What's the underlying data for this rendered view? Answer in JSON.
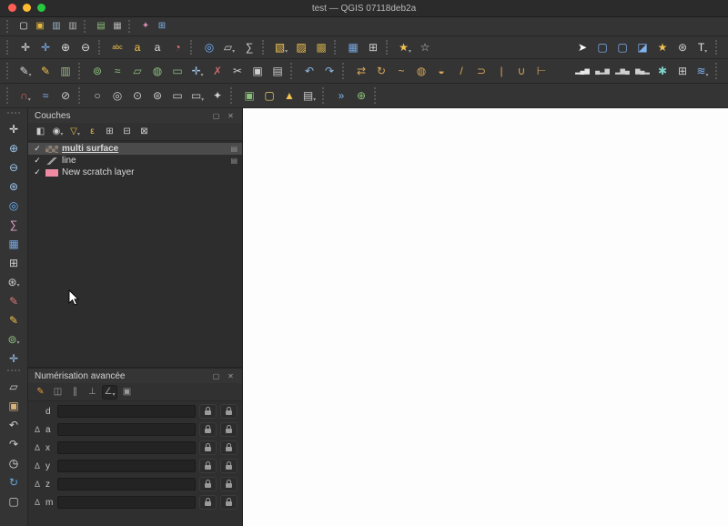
{
  "window": {
    "title": "test — QGIS 07118deb2a"
  },
  "traffic_lights": {
    "close": "#ff5f57",
    "minimize": "#febc2e",
    "zoom": "#28c840"
  },
  "toolbars": {
    "row1": [
      {
        "sep": true
      },
      {
        "n": "new-project",
        "g": "▢",
        "c": "#e8e8e8"
      },
      {
        "n": "open-project",
        "g": "▣",
        "c": "#e3b93d"
      },
      {
        "n": "save-project",
        "g": "▥",
        "c": "#9fb6c9"
      },
      {
        "n": "save-project-as",
        "g": "▥",
        "c": "#b5b5b5"
      },
      {
        "sep": true
      },
      {
        "n": "new-print-layout",
        "g": "▤",
        "c": "#8cc07a"
      },
      {
        "n": "layout-manager",
        "g": "▦",
        "c": "#b5b5b5"
      },
      {
        "sep": true
      },
      {
        "n": "style-manager",
        "g": "✦",
        "c": "#d98cb3"
      },
      {
        "n": "data-source-manager",
        "g": "⊞",
        "c": "#7fb3f0"
      }
    ],
    "row2": [
      {
        "sep": true
      },
      {
        "n": "pan-map",
        "g": "✛",
        "c": "#e0e0e0"
      },
      {
        "n": "pan-to-selection",
        "g": "✛",
        "c": "#7fb3f0"
      },
      {
        "n": "zoom-in",
        "g": "⊕",
        "c": "#dcdcdc"
      },
      {
        "n": "zoom-out",
        "g": "⊖",
        "c": "#dcdcdc"
      },
      {
        "sep": true
      },
      {
        "n": "layer-labeling",
        "g": "abc",
        "c": "#f2c14e",
        "fs": 7
      },
      {
        "n": "label-pin",
        "g": "a",
        "c": "#f2c14e"
      },
      {
        "n": "move-label",
        "g": "a",
        "c": "#dcdcdc"
      },
      {
        "n": "diagram-options",
        "g": "◔",
        "c": "#e07b7b"
      },
      {
        "sep": true
      },
      {
        "n": "identify-features",
        "g": "◎",
        "c": "#6fb3ff"
      },
      {
        "n": "measure-line",
        "g": "▱",
        "c": "#cfcfcf",
        "dd": true
      },
      {
        "n": "statistical-summary",
        "g": "∑",
        "c": "#cfcfcf"
      },
      {
        "sep": true
      },
      {
        "n": "select-by-rectangle",
        "g": "▧",
        "c": "#f2c14e",
        "dd": true
      },
      {
        "n": "select-by-value",
        "g": "▨",
        "c": "#f2c14e"
      },
      {
        "n": "deselect-all",
        "g": "▩",
        "c": "#bfa14a"
      },
      {
        "sep": true
      },
      {
        "n": "open-attribute-table",
        "g": "▦",
        "c": "#79a8e0"
      },
      {
        "n": "field-calculator",
        "g": "⊞",
        "c": "#cfcfcf"
      },
      {
        "sep": true
      },
      {
        "n": "new-bookmark",
        "g": "★",
        "c": "#f2c14e",
        "dd": true
      },
      {
        "n": "show-bookmarks",
        "g": "☆",
        "c": "#cfcfcf"
      },
      {
        "sp": true
      },
      {
        "n": "select-tool",
        "g": "➤",
        "c": "#ffffff"
      },
      {
        "n": "select-features-by-area",
        "g": "▢",
        "c": "#7fb3f0"
      },
      {
        "n": "select-by-freehand",
        "g": "▢",
        "c": "#7fb3f0"
      },
      {
        "n": "invert-selection",
        "g": "◪",
        "c": "#7fb3f0"
      },
      {
        "n": "favorites",
        "g": "★",
        "c": "#f2c14e"
      },
      {
        "n": "processing-toolbox",
        "g": "⊛",
        "c": "#cfcfcf"
      },
      {
        "n": "text-annotation",
        "g": "T",
        "c": "#e8e8e8",
        "dd": true
      },
      {
        "sep": true
      }
    ],
    "row3": [
      {
        "sep": true
      },
      {
        "n": "current-edits",
        "g": "✎",
        "c": "#dcdcdc",
        "dd": true
      },
      {
        "n": "toggle-editing",
        "g": "✎",
        "c": "#f2c14e"
      },
      {
        "n": "save-layer-edits",
        "g": "▥",
        "c": "#9fb98a"
      },
      {
        "sep": true
      },
      {
        "n": "add-point-feature",
        "g": "⊚",
        "c": "#8cc07a"
      },
      {
        "n": "add-line-feature",
        "g": "≈",
        "c": "#8cc07a"
      },
      {
        "n": "add-polygon-feature",
        "g": "▱",
        "c": "#8cc07a"
      },
      {
        "n": "add-circle-feature",
        "g": "◍",
        "c": "#8cc07a"
      },
      {
        "n": "add-rectangle-feature",
        "g": "▭",
        "c": "#8cc07a"
      },
      {
        "n": "vertex-tool",
        "g": "✛",
        "c": "#9fc3e8",
        "dd": true
      },
      {
        "n": "delete-selected",
        "g": "✗",
        "c": "#c96a6a"
      },
      {
        "n": "cut-features",
        "g": "✂",
        "c": "#cfcfcf"
      },
      {
        "n": "copy-features",
        "g": "▣",
        "c": "#cfcfcf"
      },
      {
        "n": "paste-features",
        "g": "▤",
        "c": "#cfcfcf"
      },
      {
        "sep": true
      },
      {
        "n": "undo",
        "g": "↶",
        "c": "#8fb8e8"
      },
      {
        "n": "redo",
        "g": "↷",
        "c": "#8fb8e8"
      },
      {
        "sep": true
      },
      {
        "n": "move-feature",
        "g": "⇄",
        "c": "#d8a85a"
      },
      {
        "n": "rotate-feature",
        "g": "↻",
        "c": "#d8a85a"
      },
      {
        "n": "simplify-feature",
        "g": "~",
        "c": "#d8a85a"
      },
      {
        "n": "add-ring",
        "g": "◍",
        "c": "#d8a85a"
      },
      {
        "n": "add-part",
        "g": "◒",
        "c": "#d8a85a"
      },
      {
        "n": "reshape-features",
        "g": "/",
        "c": "#d8a85a"
      },
      {
        "n": "offset-curve",
        "g": "⊃",
        "c": "#d8a85a"
      },
      {
        "n": "split-features",
        "g": "|",
        "c": "#d8a85a"
      },
      {
        "n": "merge-features",
        "g": "∪",
        "c": "#d8a85a"
      },
      {
        "n": "trim-extend",
        "g": "⊢",
        "c": "#d8a85a"
      },
      {
        "sp": true
      },
      {
        "n": "statistics-histogram",
        "g": "▂▄▆",
        "c": "#e8e8e8",
        "fs": 7
      },
      {
        "n": "histogram-variant-1",
        "g": "▄▂▆",
        "c": "#cfcfcf",
        "fs": 7
      },
      {
        "n": "histogram-variant-2",
        "g": "▂▆▄",
        "c": "#cfcfcf",
        "fs": 7
      },
      {
        "n": "histogram-variant-3",
        "g": "▆▄▂",
        "c": "#cfcfcf",
        "fs": 7
      },
      {
        "n": "processing-model",
        "g": "✱",
        "c": "#7fd0c9"
      },
      {
        "n": "raster-calculator",
        "g": "⊞",
        "c": "#cfcfcf"
      },
      {
        "n": "georeferencer",
        "g": "≋",
        "c": "#7fb3f0",
        "dd": true
      },
      {
        "sep": true
      }
    ],
    "row4": [
      {
        "sep": true
      },
      {
        "n": "snapping-options",
        "g": "∩",
        "c": "#e06666",
        "dd": true
      },
      {
        "n": "enable-tracing",
        "g": "≈",
        "c": "#7fb3f0"
      },
      {
        "n": "avoid-intersections",
        "g": "⊘",
        "c": "#cfcfcf"
      },
      {
        "sep": true
      },
      {
        "n": "circle-from-2-points",
        "g": "○",
        "c": "#cfcfcf"
      },
      {
        "n": "circle-from-3-points",
        "g": "◎",
        "c": "#cfcfcf"
      },
      {
        "n": "circle-by-center",
        "g": "⊙",
        "c": "#cfcfcf"
      },
      {
        "n": "ellipse",
        "g": "⊜",
        "c": "#cfcfcf"
      },
      {
        "n": "rectangle-from-extent",
        "g": "▭",
        "c": "#cfcfcf"
      },
      {
        "n": "rectangle-from-3-points",
        "g": "▭",
        "c": "#cfcfcf",
        "dd": true
      },
      {
        "n": "regular-polygon",
        "g": "✦",
        "c": "#cfcfcf"
      },
      {
        "sep": true
      },
      {
        "n": "new-geopackage-layer",
        "g": "▣",
        "c": "#8cc07a"
      },
      {
        "n": "new-shapefile-layer",
        "g": "▢",
        "c": "#e8c96a"
      },
      {
        "n": "new-virtual-layer",
        "g": "▲",
        "c": "#f2c14e"
      },
      {
        "n": "new-temporary-scratch-layer",
        "g": "▤",
        "c": "#c9c9c9",
        "dd": true
      },
      {
        "sep": true
      },
      {
        "n": "python-console",
        "g": "»",
        "c": "#7fb3f0"
      },
      {
        "n": "osm-place-search",
        "g": "⊕",
        "c": "#8cc07a"
      },
      {
        "sep": true
      }
    ]
  },
  "left_toolbar": [
    {
      "sep": true
    },
    {
      "n": "pan-map-tool",
      "g": "✛",
      "c": "#f0f0f0"
    },
    {
      "n": "zoom-in-tool",
      "g": "⊕",
      "c": "#9ec7f0"
    },
    {
      "n": "zoom-out-tool",
      "g": "⊖",
      "c": "#9ec7f0"
    },
    {
      "n": "zoom-full-extent",
      "g": "⊛",
      "c": "#9ec7f0"
    },
    {
      "n": "identify-tool",
      "g": "◎",
      "c": "#6fb3ff"
    },
    {
      "n": "statistics-sum",
      "g": "∑",
      "c": "#e3a6c8"
    },
    {
      "n": "attribute-table",
      "g": "▦",
      "c": "#79a8e0"
    },
    {
      "n": "field-calc",
      "g": "⊞",
      "c": "#cfcfcf"
    },
    {
      "n": "options-gear",
      "g": "⊛",
      "c": "#cfcfcf",
      "dd": true
    },
    {
      "n": "edit-pencil-red",
      "g": "✎",
      "c": "#d97b7b"
    },
    {
      "n": "edit-pencil-yellow",
      "g": "✎",
      "c": "#f2c14e"
    },
    {
      "n": "add-feature-tool",
      "g": "⊚",
      "c": "#8cc07a",
      "dd": true
    },
    {
      "n": "vertex-editor",
      "g": "✛",
      "c": "#9fc3e8"
    },
    {
      "sep": true
    },
    {
      "n": "measure-tool",
      "g": "▱",
      "c": "#cfcfcf"
    },
    {
      "n": "clipboard-tool",
      "g": "▣",
      "c": "#d8b27a"
    },
    {
      "n": "undo-tool",
      "g": "↶",
      "c": "#cfcfcf"
    },
    {
      "n": "redo-tool",
      "g": "↷",
      "c": "#cfcfcf"
    },
    {
      "n": "temporal-controller",
      "g": "◷",
      "c": "#e8e8e8"
    },
    {
      "n": "refresh-map",
      "g": "↻",
      "c": "#5fa8e0"
    },
    {
      "n": "log-messages",
      "g": "▢",
      "c": "#cfcfcf"
    }
  ],
  "layers_panel": {
    "title": "Couches",
    "buttons": {
      "float": "▢",
      "close": "✕"
    },
    "toolbar": [
      {
        "n": "open-layer-styling",
        "g": "◧",
        "c": "#cfcfcf"
      },
      {
        "n": "manage-map-themes",
        "g": "◉",
        "c": "#cfcfcf",
        "dd": true
      },
      {
        "n": "filter-legend",
        "g": "▽",
        "c": "#f2c14e",
        "dd": true
      },
      {
        "n": "filter-by-expression",
        "g": "ε",
        "c": "#f2c14e"
      },
      {
        "n": "expand-all",
        "g": "⊞",
        "c": "#cfcfcf"
      },
      {
        "n": "collapse-all",
        "g": "⊟",
        "c": "#cfcfcf"
      },
      {
        "n": "remove-layer",
        "g": "⊠",
        "c": "#cfcfcf"
      }
    ],
    "layers": [
      {
        "name": "multi surface",
        "checked": "✓",
        "swatch": "checker",
        "selected": true,
        "indicator": "▤"
      },
      {
        "name": "line",
        "checked": "✓",
        "swatch": "line",
        "selected": false,
        "indicator": "▤"
      },
      {
        "name": "New scratch layer",
        "checked": "✓",
        "swatch": "#ee8aa2",
        "selected": false
      }
    ]
  },
  "digitizing_panel": {
    "title": "Numérisation avancée",
    "buttons": {
      "float": "▢",
      "close": "✕"
    },
    "delta_symbol": "Δ",
    "toolbar": [
      {
        "n": "enable-advanced-digitizing",
        "g": "✎",
        "c": "#e8973d"
      },
      {
        "n": "construction-mode",
        "g": "◫",
        "c": "#9a9a9a"
      },
      {
        "n": "parallel-constraint",
        "g": "∥",
        "c": "#9a9a9a"
      },
      {
        "n": "perpendicular-constraint",
        "g": "⊥",
        "c": "#9a9a9a"
      },
      {
        "n": "snap-to-common-angles",
        "g": "∠",
        "c": "#9a9a9a",
        "on": true,
        "dd": true
      },
      {
        "n": "floater-settings",
        "g": "▣",
        "c": "#9a9a9a"
      }
    ],
    "fields": [
      {
        "label": "d",
        "delta": false
      },
      {
        "label": "a",
        "delta": true
      },
      {
        "label": "x",
        "delta": true
      },
      {
        "label": "y",
        "delta": true
      },
      {
        "label": "z",
        "delta": true
      },
      {
        "label": "m",
        "delta": true
      }
    ]
  }
}
